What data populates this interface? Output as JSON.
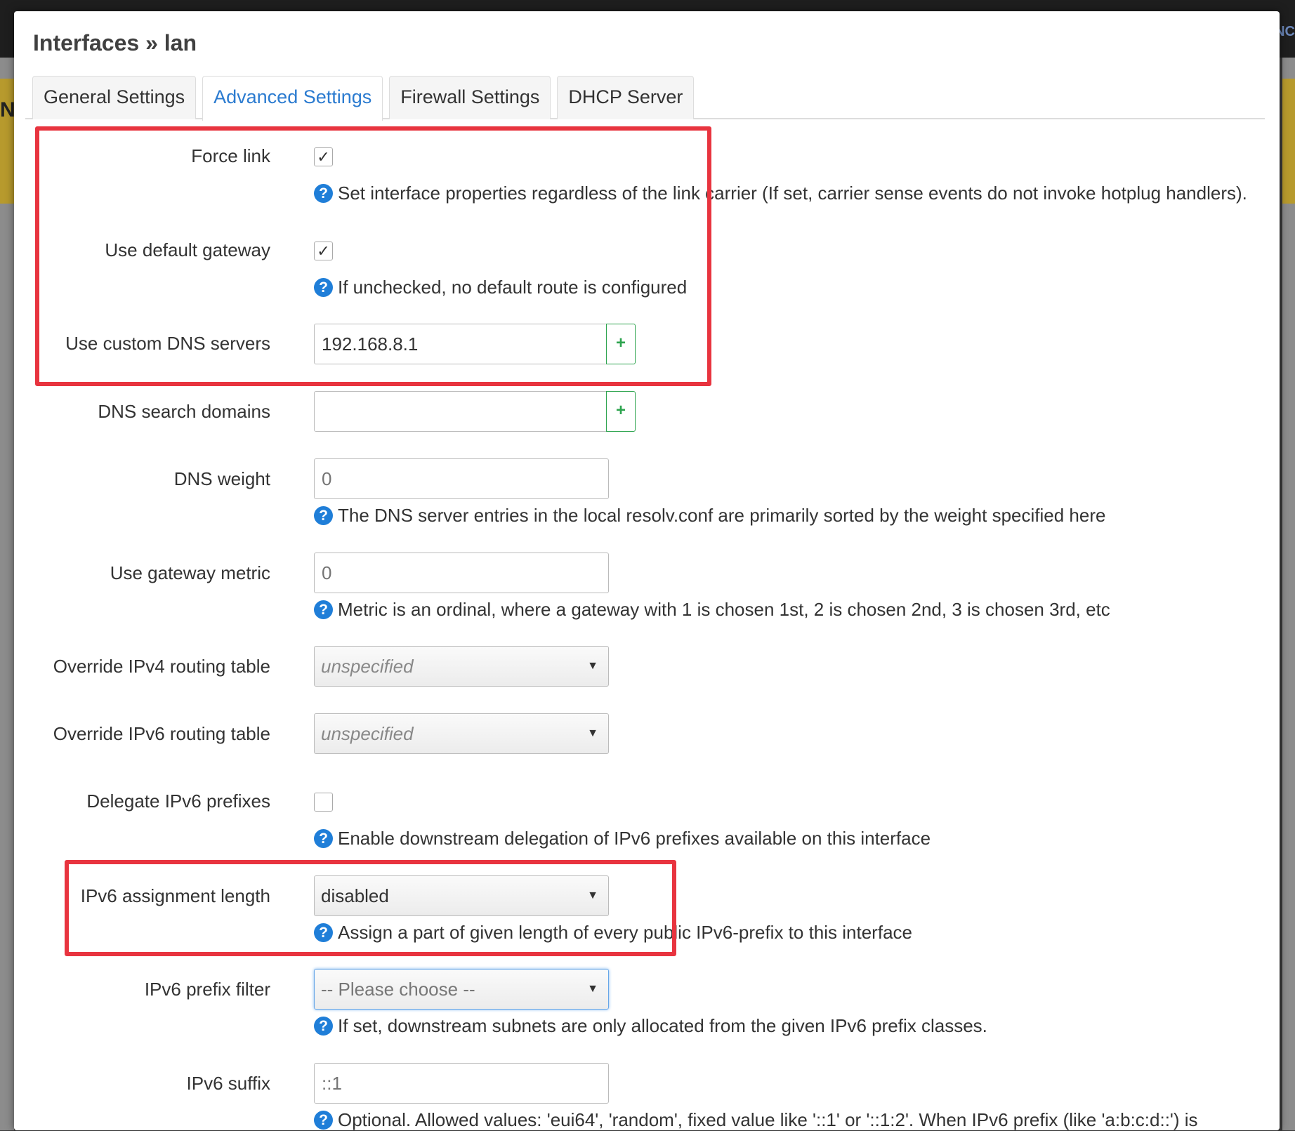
{
  "title": "Interfaces » lan",
  "tabs": [
    {
      "label": "General Settings"
    },
    {
      "label": "Advanced Settings"
    },
    {
      "label": "Firewall Settings"
    },
    {
      "label": "DHCP Server"
    }
  ],
  "active_tab": "Advanced Settings",
  "fields": {
    "force_link": {
      "label": "Force link",
      "checked": true,
      "help": "Set interface properties regardless of the link carrier (If set, carrier sense events do not invoke hotplug handlers)."
    },
    "default_gateway": {
      "label": "Use default gateway",
      "checked": true,
      "help": "If unchecked, no default route is configured"
    },
    "custom_dns": {
      "label": "Use custom DNS servers",
      "value": "192.168.8.1",
      "add": "+"
    },
    "dns_search": {
      "label": "DNS search domains",
      "value": "",
      "add": "+"
    },
    "dns_weight": {
      "label": "DNS weight",
      "placeholder": "0",
      "help": "The DNS server entries in the local resolv.conf are primarily sorted by the weight specified here"
    },
    "gateway_metric": {
      "label": "Use gateway metric",
      "placeholder": "0",
      "help": "Metric is an ordinal, where a gateway with 1 is chosen 1st, 2 is chosen 2nd, 3 is chosen 3rd, etc"
    },
    "ipv4_table": {
      "label": "Override IPv4 routing table",
      "value": "unspecified"
    },
    "ipv6_table": {
      "label": "Override IPv6 routing table",
      "value": "unspecified"
    },
    "delegate_ipv6": {
      "label": "Delegate IPv6 prefixes",
      "checked": false,
      "help": "Enable downstream delegation of IPv6 prefixes available on this interface"
    },
    "ipv6_assign_length": {
      "label": "IPv6 assignment length",
      "value": "disabled",
      "help": "Assign a part of given length of every public IPv6-prefix to this interface"
    },
    "ipv6_prefix_filter": {
      "label": "IPv6 prefix filter",
      "value": "-- Please choose --",
      "help": "If set, downstream subnets are only allocated from the given IPv6 prefix classes."
    },
    "ipv6_suffix": {
      "label": "IPv6 suffix",
      "placeholder": "::1",
      "help": "Optional. Allowed values: 'eui64', 'random', fixed value like '::1' or '::1:2'. When IPv6 prefix (like 'a:b:c:d::') is"
    }
  },
  "icons": {
    "help": "question-circle-icon",
    "checkmark": "checkmark-icon",
    "dropdown": "caret-down-icon"
  },
  "glyphs": {
    "help": "?",
    "check": "✓",
    "caret": "▼"
  },
  "background": {
    "left_fragment": "N",
    "right_fragment": "INC"
  },
  "colors": {
    "accent": "#2b7bd0",
    "help_icon": "#1f7ed8",
    "add_button": "#2ea44f",
    "highlight_box": "#e8343f"
  }
}
